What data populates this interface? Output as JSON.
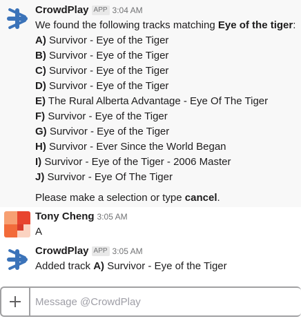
{
  "messages": [
    {
      "sender": "CrowdPlay",
      "badge": "APP",
      "time": "3:04 AM",
      "avatar_icon": "crowdplay-logo-icon",
      "intro_prefix": "We found the following tracks matching ",
      "intro_query": "Eye of the tiger",
      "intro_suffix": ":",
      "tracks": [
        {
          "key": "A)",
          "title": "Survivor - Eye of the Tiger"
        },
        {
          "key": "B)",
          "title": "Survivor - Eye of the Tiger"
        },
        {
          "key": "C)",
          "title": "Survivor - Eye of the Tiger"
        },
        {
          "key": "D)",
          "title": "Survivor - Eye of the Tiger"
        },
        {
          "key": "E)",
          "title": "The Rural Alberta Advantage - Eye Of The Tiger"
        },
        {
          "key": "F)",
          "title": "Survivor - Eye of the Tiger"
        },
        {
          "key": "G)",
          "title": "Survivor - Eye of the Tiger"
        },
        {
          "key": "H)",
          "title": "Survivor - Ever Since the World Began"
        },
        {
          "key": "I)",
          "title": "Survivor - Eye of the Tiger - 2006 Master"
        },
        {
          "key": "J)",
          "title": "Survivor - Eye Of The Tiger"
        }
      ],
      "outro_prefix": "Please make a selection or type ",
      "outro_cmd": "cancel",
      "outro_suffix": "."
    },
    {
      "sender": "Tony Cheng",
      "time": "3:05 AM",
      "avatar_icon": "user-avatar",
      "text": "A"
    },
    {
      "sender": "CrowdPlay",
      "badge": "APP",
      "time": "3:05 AM",
      "avatar_icon": "crowdplay-logo-icon",
      "text_prefix": "Added track ",
      "text_key": "A)",
      "text_title": "Survivor - Eye of the Tiger"
    }
  ],
  "composer": {
    "placeholder": "Message @CrowdPlay",
    "attach_icon": "plus-icon"
  },
  "colors": {
    "logo_blue": "#3b73b9",
    "avatar_orange": "#f26b3a",
    "avatar_red": "#d93b2b",
    "avatar_peach": "#f7a073",
    "avatar_light": "#fbd3c1"
  }
}
